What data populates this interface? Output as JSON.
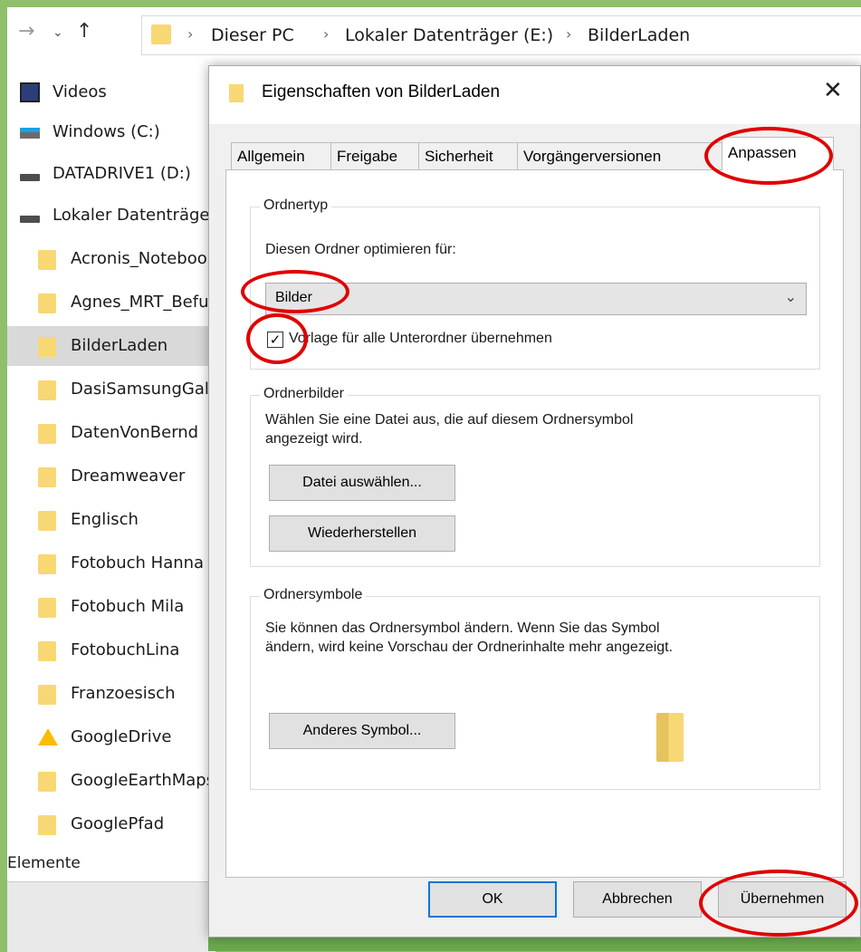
{
  "explorer": {
    "nav": {
      "back_icon": "→",
      "history_icon": "⌄",
      "up_icon": "↑"
    },
    "breadcrumb": [
      "Dieser PC",
      "Lokaler Datenträger (E:)",
      "BilderLaden"
    ],
    "breadcrumb_sep": "›",
    "sidebar": [
      {
        "label": "Videos",
        "icon": "video-icon"
      },
      {
        "label": "Windows (C:)",
        "icon": "windows-drive-icon"
      },
      {
        "label": "DATADRIVE1 (D:)",
        "icon": "drive-icon"
      },
      {
        "label": "Lokaler Datenträger (E:)",
        "icon": "drive-icon"
      },
      {
        "label": "Acronis_Notebook",
        "icon": "folder-icon"
      },
      {
        "label": "Agnes_MRT_Befund",
        "icon": "folder-icon"
      },
      {
        "label": "BilderLaden",
        "icon": "folder-icon",
        "selected": true
      },
      {
        "label": "DasiSamsungGalaxy",
        "icon": "folder-icon"
      },
      {
        "label": "DatenVonBernd",
        "icon": "folder-icon"
      },
      {
        "label": "Dreamweaver",
        "icon": "folder-icon"
      },
      {
        "label": "Englisch",
        "icon": "folder-icon"
      },
      {
        "label": "Fotobuch Hanna",
        "icon": "folder-icon"
      },
      {
        "label": "Fotobuch Mila",
        "icon": "folder-icon"
      },
      {
        "label": "FotobuchLina",
        "icon": "folder-icon"
      },
      {
        "label": "Franzoesisch",
        "icon": "folder-icon"
      },
      {
        "label": "GoogleDrive",
        "icon": "google-drive-icon"
      },
      {
        "label": "GoogleEarthMaps",
        "icon": "folder-icon"
      },
      {
        "label": "GooglePfad",
        "icon": "folder-icon"
      }
    ],
    "status": "Elemente"
  },
  "dialog": {
    "title": "Eigenschaften von BilderLaden",
    "close_icon": "✕",
    "tabs": [
      {
        "label": "Allgemein"
      },
      {
        "label": "Freigabe"
      },
      {
        "label": "Sicherheit"
      },
      {
        "label": "Vorgängerversionen"
      },
      {
        "label": "Anpassen",
        "active": true
      }
    ],
    "ordnertyp": {
      "title": "Ordnertyp",
      "prompt": "Diesen Ordner optimieren für:",
      "selected": "Bilder",
      "checkbox_checked": true,
      "checkbox_label": "Vorlage für alle Unterordner übernehmen"
    },
    "ordnerbilder": {
      "title": "Ordnerbilder",
      "text1": "Wählen Sie eine Datei aus, die auf diesem Ordnersymbol",
      "text2": "angezeigt wird.",
      "choose_button": "Datei auswählen...",
      "restore_button": "Wiederherstellen"
    },
    "ordnersymbole": {
      "title": "Ordnersymbole",
      "text1": "Sie können das Ordnersymbol ändern. Wenn Sie das Symbol",
      "text2": "ändern, wird keine Vorschau der Ordnerinhalte mehr angezeigt.",
      "change_button": "Anderes Symbol..."
    },
    "footer": {
      "ok": "OK",
      "cancel": "Abbrechen",
      "apply": "Übernehmen"
    }
  },
  "annotation_color": "#e00000"
}
